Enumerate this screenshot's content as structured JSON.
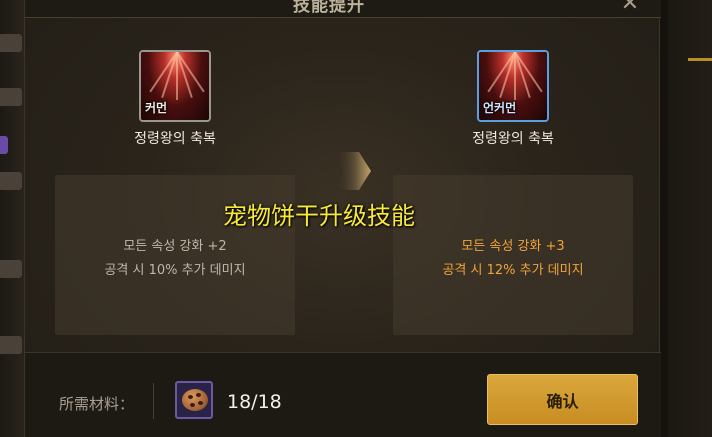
{
  "dialog": {
    "title": "技能提升",
    "close_icon": "close-icon"
  },
  "skills": {
    "current": {
      "grade": "커먼",
      "name": "정령왕의 축복",
      "effects": [
        "모든 속성 강화 +2",
        "공격 시 10% 추가 데미지"
      ],
      "border_color": "#9a9690"
    },
    "next": {
      "grade": "언커먼",
      "name": "정령왕의 축복",
      "effects": [
        "모든 속성 강화 +3",
        "공격 시 12% 추가 데미지"
      ],
      "border_color": "#5aa0e0"
    }
  },
  "overlay": {
    "caption": "宠物饼干升级技能"
  },
  "footer": {
    "materials_label": "所需材料：",
    "item_icon": "cookie-icon",
    "item_count": "18/18",
    "confirm_label": "确认"
  },
  "colors": {
    "accent": "#c88d22",
    "upgrade_text": "#f0a43a",
    "caption": "#f7e83a"
  }
}
